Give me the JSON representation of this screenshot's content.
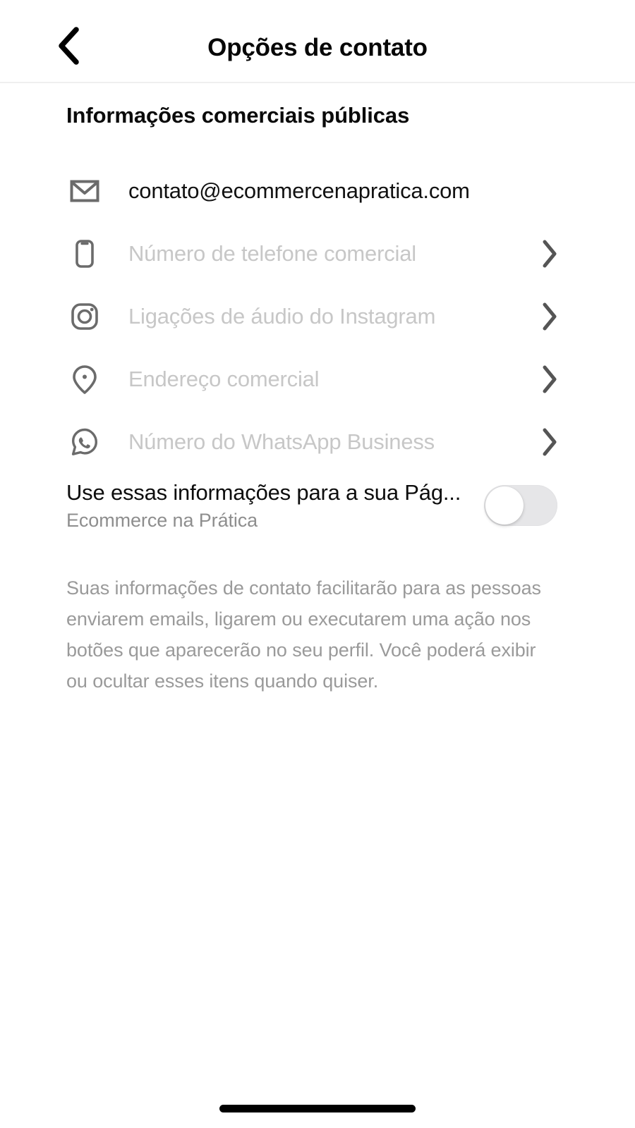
{
  "header": {
    "back_icon": "chevron-left-icon",
    "title": "Opções de contato"
  },
  "section": {
    "title": "Informações comerciais públicas"
  },
  "rows": [
    {
      "icon": "envelope-icon",
      "label": "contato@ecommercenapratica.com",
      "filled": true,
      "chevron": false
    },
    {
      "icon": "phone-icon",
      "label": "Número de telefone comercial",
      "filled": false,
      "chevron": true
    },
    {
      "icon": "instagram-icon",
      "label": "Ligações de áudio do Instagram",
      "filled": false,
      "chevron": true
    },
    {
      "icon": "map-pin-icon",
      "label": "Endereço comercial",
      "filled": false,
      "chevron": true
    },
    {
      "icon": "whatsapp-icon",
      "label": "Número do WhatsApp Business",
      "filled": false,
      "chevron": true
    }
  ],
  "page_toggle": {
    "title": "Use essas informações para a sua Pág...",
    "subtitle": "Ecommerce na Prática",
    "state": "off"
  },
  "footer": {
    "note": "Suas informações de contato facilitarão para as pessoas enviarem emails, ligarem ou executarem uma ação nos botões que aparecerão no seu perfil. Você poderá exibir ou ocultar esses itens quando quiser."
  },
  "colors": {
    "text_primary": "#0d0d0d",
    "text_placeholder": "#c7c7c7",
    "text_secondary": "#8e8e8e",
    "icon": "#6b6b6b",
    "divider": "#efefef",
    "toggle_off_track": "#e6e6e8"
  }
}
